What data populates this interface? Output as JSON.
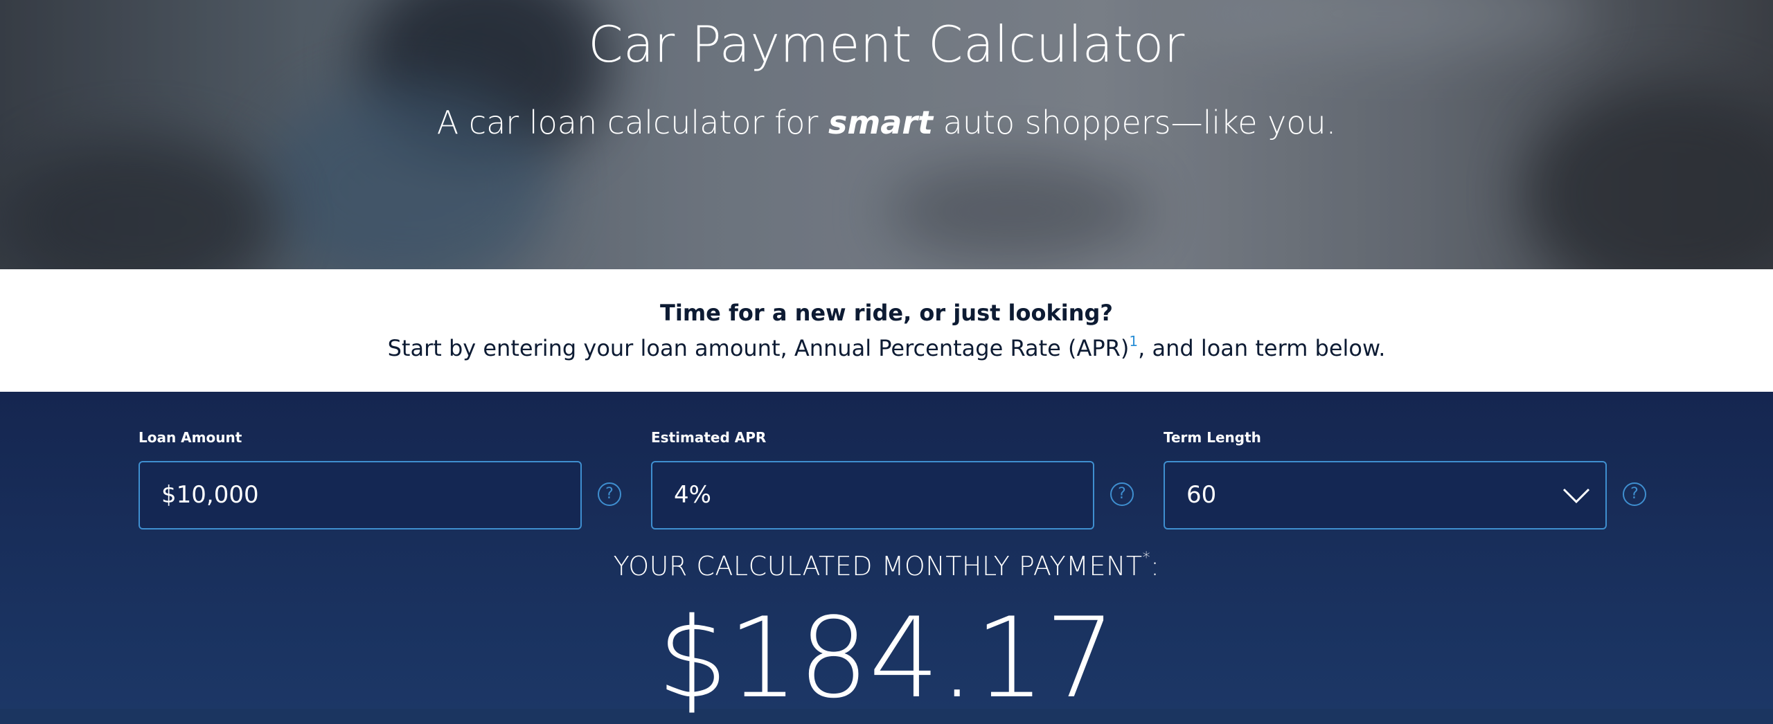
{
  "hero": {
    "title": "Car Payment Calculator",
    "subtitle_pre": "A car loan calculator for ",
    "subtitle_em": "smart",
    "subtitle_post": " auto shoppers—like you."
  },
  "intro": {
    "heading": "Time for a new ride, or just looking?",
    "body_pre": "Start by entering your loan amount, Annual Percentage Rate (APR)",
    "footnote": "1",
    "body_post": ", and loan term below."
  },
  "calculator": {
    "loan_amount": {
      "label": "Loan Amount",
      "value": "$10,000"
    },
    "apr": {
      "label": "Estimated APR",
      "value": "4%"
    },
    "term": {
      "label": "Term Length",
      "value": "60"
    },
    "help_icon_glyph": "?",
    "result_label": "YOUR CALCULATED MONTHLY PAYMENT",
    "result_asterisk": "*",
    "result_colon": ":",
    "result_value": "$184.17"
  },
  "colors": {
    "accent": "#3f8fd0",
    "panel_dark": "#152650",
    "panel_light": "#1c3766",
    "text_dark": "#0d1b33"
  },
  "icons": {
    "help": "help-circle-icon",
    "dropdown": "chevron-down-icon"
  }
}
